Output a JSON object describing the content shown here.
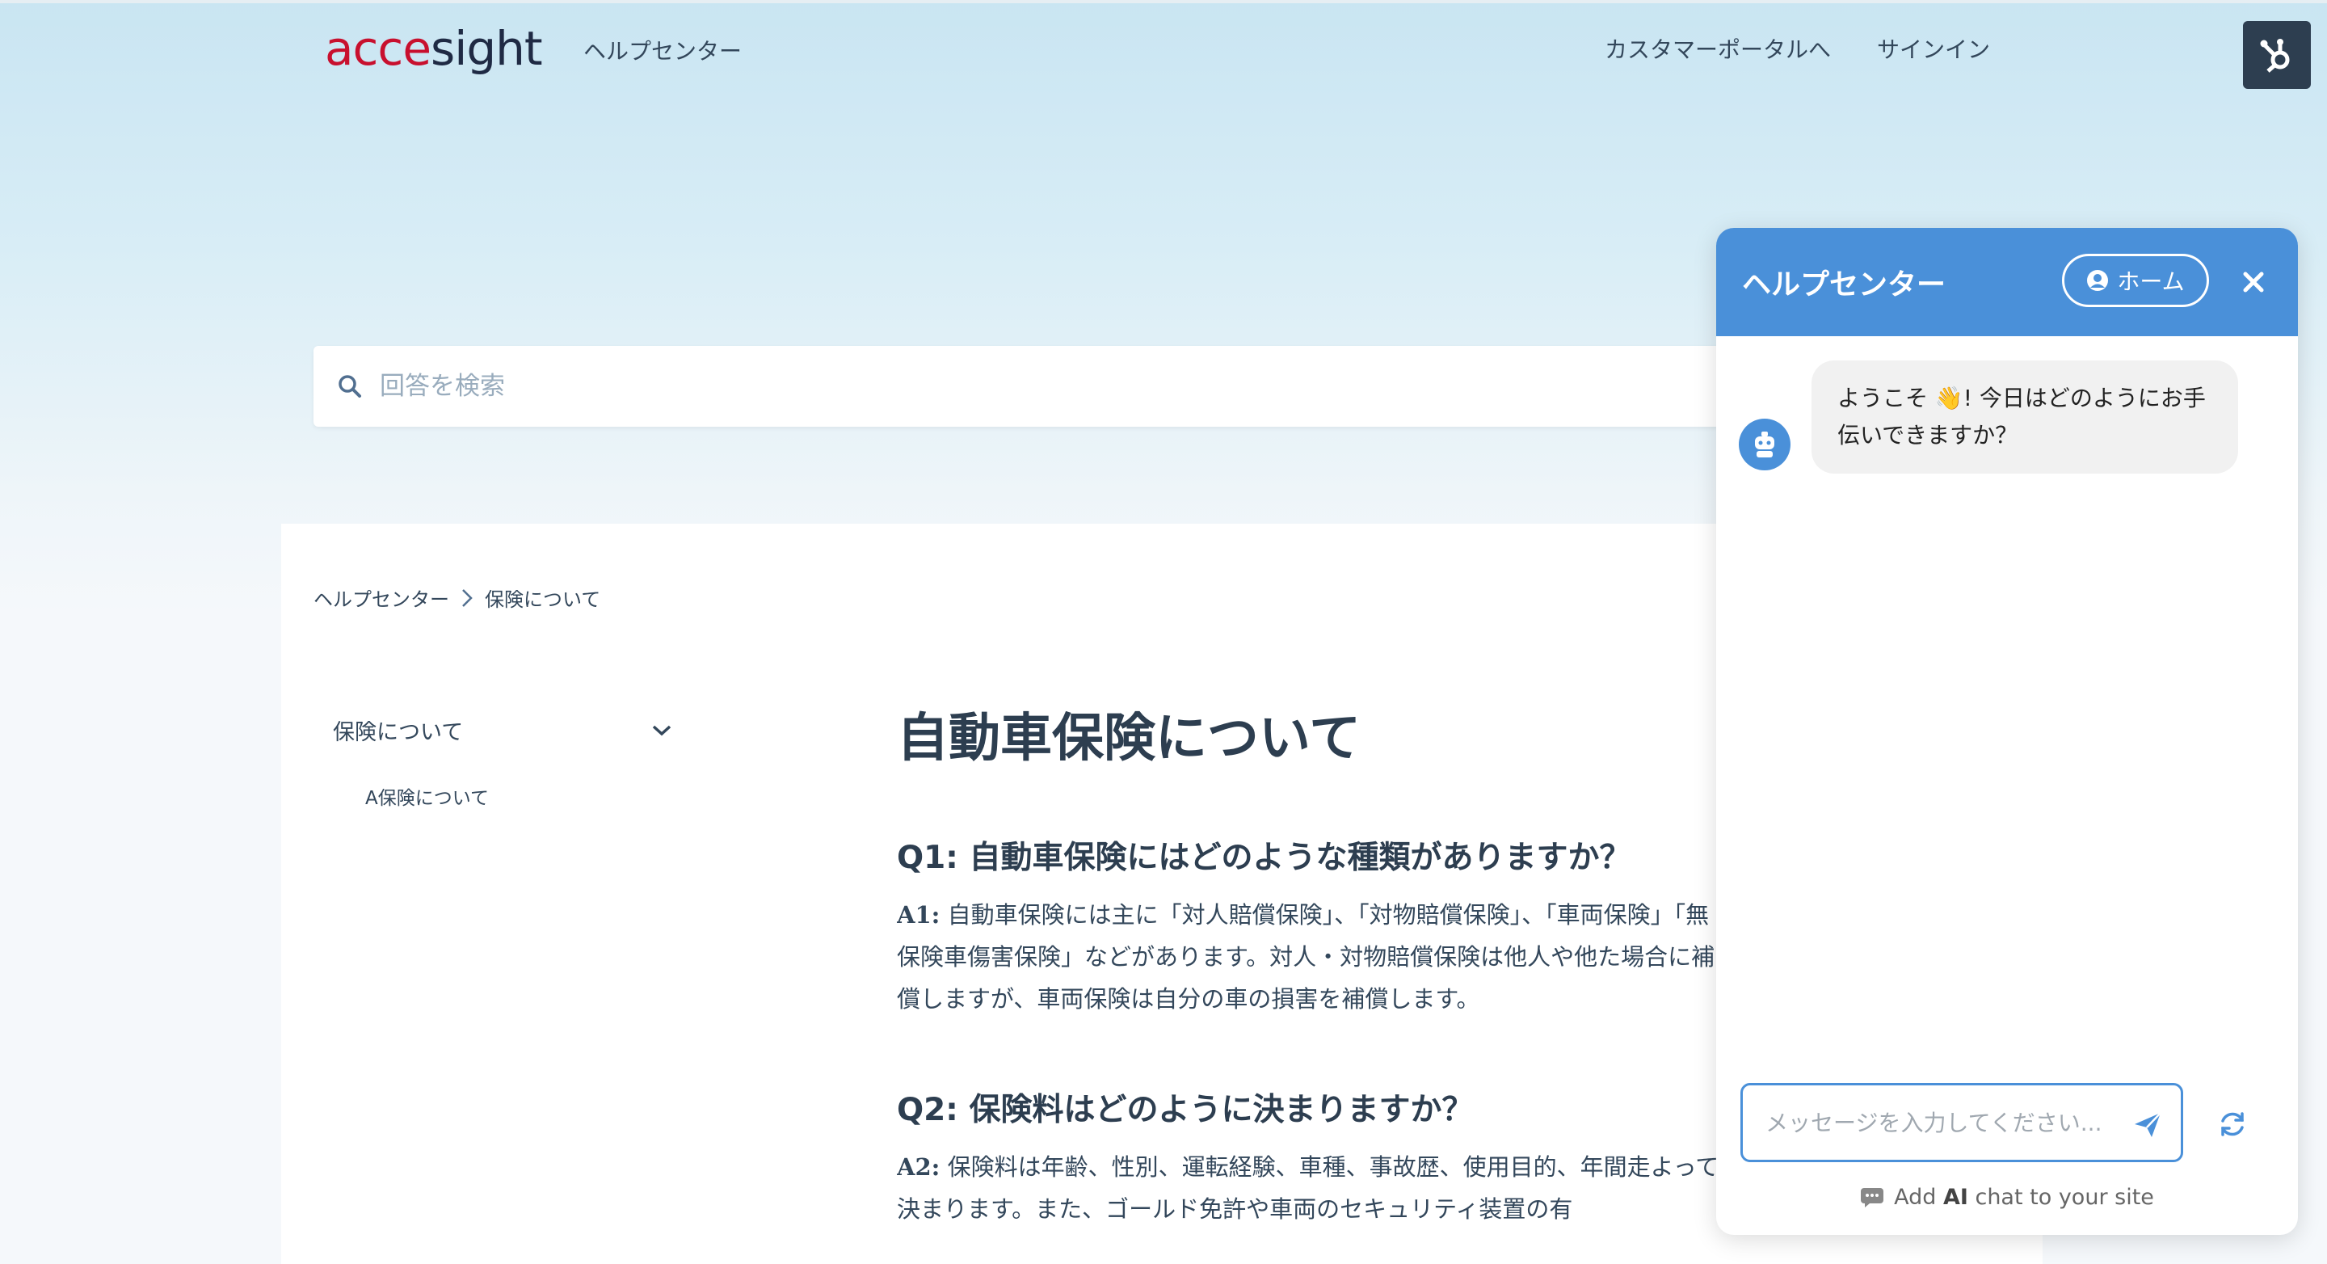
{
  "header": {
    "logo_part1": "acce",
    "logo_part2": "sight",
    "help_center": "ヘルプセンター",
    "customer_portal": "カスタマーポータルへ",
    "sign_in": "サインイン"
  },
  "search": {
    "placeholder": "回答を検索"
  },
  "breadcrumb": {
    "items": [
      "ヘルプセンター",
      "保険について"
    ]
  },
  "sidebar": {
    "category": "保険について",
    "sub_items": [
      "A保険について"
    ]
  },
  "article": {
    "title": "自動車保険について",
    "qas": [
      {
        "question": "Q1: 自動車保険にはどのような種類がありますか？",
        "answer_label": "A1:",
        "answer": " 自動車保険には主に「対人賠償保険」、「対物賠償保険」、「車両保険」「無保険車傷害保険」などがあります。対人・対物賠償保険は他人や他た場合に補償しますが、車両保険は自分の車の損害を補償します。"
      },
      {
        "question": "Q2: 保険料はどのように決まりますか？",
        "answer_label": "A2:",
        "answer": " 保険料は年齢、性別、運転経験、車種、事故歴、使用目的、年間走よって決まります。また、ゴールド免許や車両のセキュリティ装置の有"
      }
    ]
  },
  "chat": {
    "title": "ヘルプセンター",
    "home_button": "ホーム",
    "greeting": "ようこそ 👋! 今日はどのようにお手伝いできますか？",
    "input_placeholder": "メッセージを入力してください...",
    "footer_prefix": "Add ",
    "footer_bold": "AI",
    "footer_suffix": " chat to your site",
    "accent_color": "#4a90d9"
  },
  "colors": {
    "brand_red": "#c8102e",
    "brand_dark": "#1f2a44",
    "text": "#33475b",
    "hubspot_bg": "#2d3e50"
  }
}
